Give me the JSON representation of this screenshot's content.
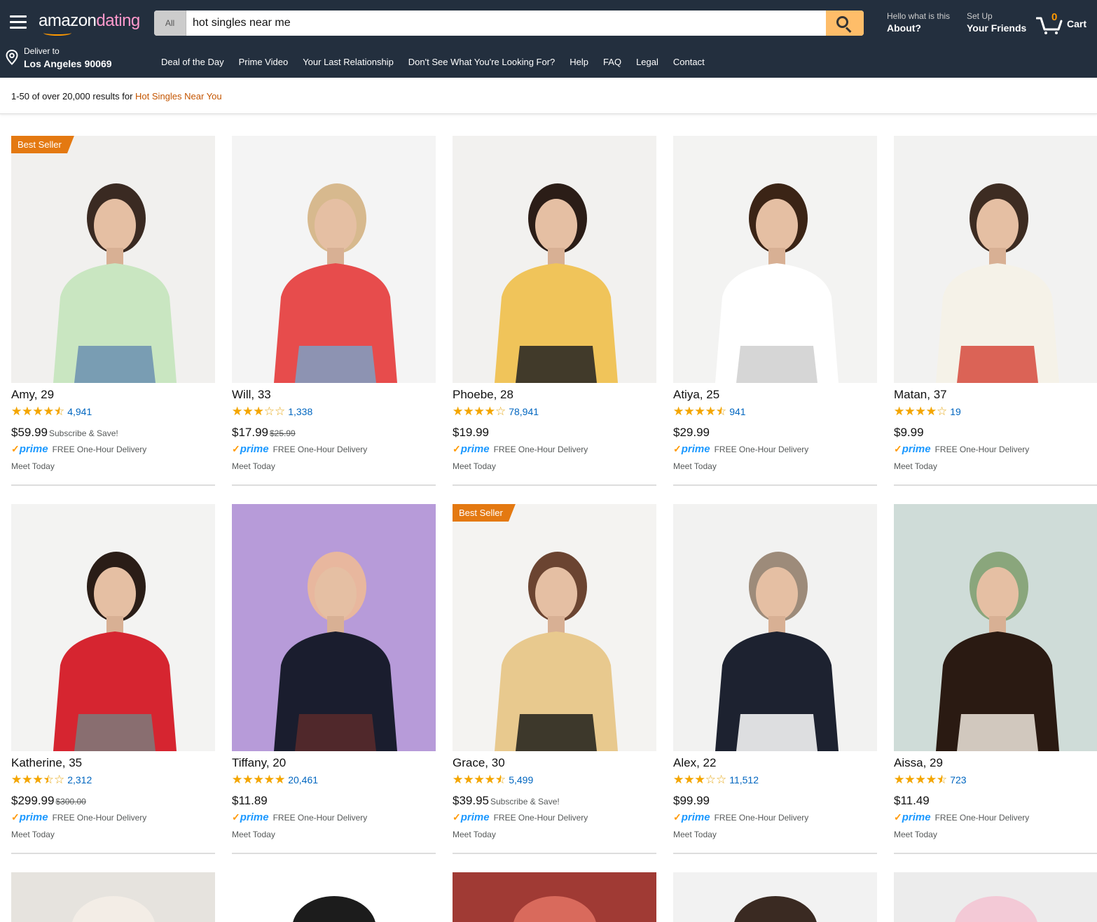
{
  "header": {
    "logo_main": "amazon",
    "logo_accent": "dating",
    "search_category": "All",
    "search_value": "hot singles near me",
    "about_small": "Hello what is this",
    "about_big": "About?",
    "friends_small": "Set Up",
    "friends_big": "Your Friends",
    "cart_count": "0",
    "cart_label": "Cart",
    "deliver_small": "Deliver to",
    "deliver_big": "Los Angeles 90069",
    "accent_color": "#febd69",
    "bg_color": "#232f3e"
  },
  "subnav": [
    "Deal of the Day",
    "Prime Video",
    "Your Last Relationship",
    "Don't See What You're Looking For?",
    "Help",
    "FAQ",
    "Legal",
    "Contact"
  ],
  "results": {
    "prefix": "1-50 of over 20,000 results for ",
    "query": "Hot Singles Near You"
  },
  "cards": [
    {
      "name": "Amy, 29",
      "rating": 4.5,
      "reviews": "4,941",
      "price": "$59.99",
      "old_price": "",
      "subscribe": "Subscribe & Save!",
      "badge": "Best Seller",
      "prime": "prime",
      "delivery": "FREE One-Hour Delivery",
      "meet": "Meet Today",
      "photo_colors": [
        "#f1f0ee",
        "#c9e6c1",
        "#6b8fb0",
        "#3a2a22"
      ]
    },
    {
      "name": "Will, 33",
      "rating": 3,
      "reviews": "1,338",
      "price": "$17.99",
      "old_price": "$25.99",
      "subscribe": "",
      "badge": "",
      "prime": "prime",
      "delivery": "FREE One-Hour Delivery",
      "meet": "Meet Today",
      "photo_colors": [
        "#f4f4f4",
        "#e74c4c",
        "#7da0c4",
        "#d7b98e"
      ]
    },
    {
      "name": "Phoebe, 28",
      "rating": 4,
      "reviews": "78,941",
      "price": "$19.99",
      "old_price": "",
      "subscribe": "",
      "badge": "",
      "prime": "prime",
      "delivery": "FREE One-Hour Delivery",
      "meet": "Meet Today",
      "photo_colors": [
        "#f2f1ef",
        "#f0c45a",
        "#222222",
        "#2b1d17"
      ]
    },
    {
      "name": "Atiya, 25",
      "rating": 4.5,
      "reviews": "941",
      "price": "$29.99",
      "old_price": "",
      "subscribe": "",
      "badge": "",
      "prime": "prime",
      "delivery": "FREE One-Hour Delivery",
      "meet": "Meet Today",
      "photo_colors": [
        "#f3f3f2",
        "#ffffff",
        "#cfcfcf",
        "#3b2416"
      ]
    },
    {
      "name": "Matan, 37",
      "rating": 4,
      "reviews": "19",
      "price": "$9.99",
      "old_price": "",
      "subscribe": "",
      "badge": "",
      "prime": "prime",
      "delivery": "FREE One-Hour Delivery",
      "meet": "Meet Today",
      "photo_colors": [
        "#f2f2f1",
        "#f5f2e8",
        "#d64a3c",
        "#3d2c22"
      ]
    },
    {
      "name": "Katherine, 35",
      "rating": 3.5,
      "reviews": "2,312",
      "price": "$299.99",
      "old_price": "$300.00",
      "subscribe": "",
      "badge": "",
      "prime": "prime",
      "delivery": "FREE One-Hour Delivery",
      "meet": "Meet Today",
      "photo_colors": [
        "#f3f3f2",
        "#d62530",
        "#7b7b7b",
        "#2a1d17"
      ]
    },
    {
      "name": "Tiffany, 20",
      "rating": 5,
      "reviews": "20,461",
      "price": "$11.89",
      "old_price": "",
      "subscribe": "",
      "badge": "",
      "prime": "prime",
      "delivery": "FREE One-Hour Delivery",
      "meet": "Meet Today",
      "photo_colors": [
        "#b79bd9",
        "#1a1d2e",
        "#5a2a2a",
        "#e8b79e"
      ]
    },
    {
      "name": "Grace, 30",
      "rating": 4.5,
      "reviews": "5,499",
      "price": "$39.95",
      "old_price": "",
      "subscribe": "Subscribe & Save!",
      "badge": "Best Seller",
      "prime": "prime",
      "delivery": "FREE One-Hour Delivery",
      "meet": "Meet Today",
      "photo_colors": [
        "#f4f3f1",
        "#e8c98e",
        "#1f1f1a",
        "#6b4431"
      ]
    },
    {
      "name": "Alex, 22",
      "rating": 3,
      "reviews": "11,512",
      "price": "$99.99",
      "old_price": "",
      "subscribe": "",
      "badge": "",
      "prime": "prime",
      "delivery": "FREE One-Hour Delivery",
      "meet": "Meet Today",
      "photo_colors": [
        "#f2f2f1",
        "#1d2230",
        "#ffffff",
        "#9d8b7a"
      ]
    },
    {
      "name": "Aissa, 29",
      "rating": 4.5,
      "reviews": "723",
      "price": "$11.49",
      "old_price": "",
      "subscribe": "",
      "badge": "",
      "prime": "prime",
      "delivery": "FREE One-Hour Delivery",
      "meet": "Meet Today",
      "photo_colors": [
        "#cfdcd8",
        "#2a1a12",
        "#efe7dd",
        "#8aa67c"
      ]
    }
  ],
  "peek_photos": [
    [
      "#e6e3de",
      "#f3ede6"
    ],
    [
      "#ffffff",
      "#1c1c1c"
    ],
    [
      "#a03a34",
      "#d96a5c"
    ],
    [
      "#f2f2f2",
      "#3a2a22"
    ],
    [
      "#ececec",
      "#f3c9d6"
    ]
  ]
}
